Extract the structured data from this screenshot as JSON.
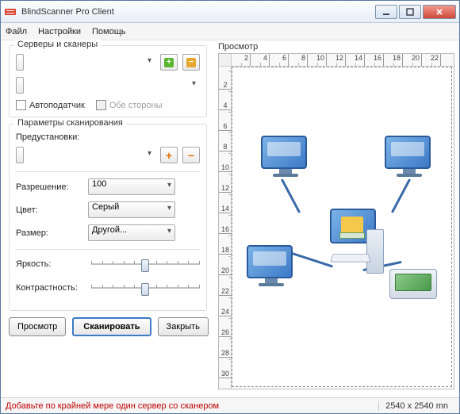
{
  "window": {
    "title": "BlindScanner Pro Client"
  },
  "menu": {
    "file": "Файл",
    "settings": "Настройки",
    "help": "Помощь"
  },
  "servers_group": {
    "label": "Серверы и сканеры",
    "server_select": "",
    "scanner_select": "",
    "auto_feeder": "Автоподатчик",
    "both_sides": "Обе стороны"
  },
  "params_group": {
    "label": "Параметры сканирования",
    "presets_label": "Предустановки:",
    "preset_value": "",
    "resolution_label": "Разрешение:",
    "resolution_value": "100",
    "color_label": "Цвет:",
    "color_value": "Серый",
    "size_label": "Размер:",
    "size_value": "Другой...",
    "brightness_label": "Яркость:",
    "contrast_label": "Контрастность:"
  },
  "buttons": {
    "preview": "Просмотр",
    "scan": "Сканировать",
    "close": "Закрыть"
  },
  "preview": {
    "label": "Просмотр",
    "ruler_h": [
      "2",
      "4",
      "6",
      "8",
      "10",
      "12",
      "14",
      "16",
      "18",
      "20",
      "22"
    ],
    "ruler_v": [
      "2",
      "4",
      "6",
      "8",
      "10",
      "12",
      "14",
      "16",
      "18",
      "20",
      "22",
      "24",
      "26",
      "28",
      "30"
    ]
  },
  "status": {
    "message": "Добавьте по крайней мере один сервер со сканером",
    "dimensions": "2540 x 2540 mn"
  }
}
